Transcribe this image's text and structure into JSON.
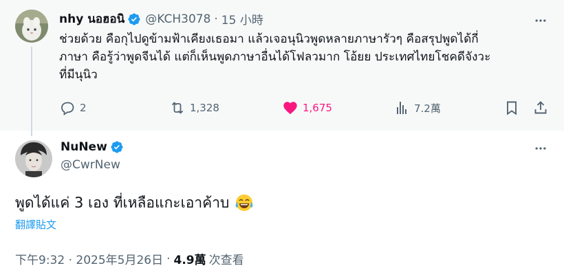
{
  "original_tweet": {
    "display_name": "nhy นอฮอนิ",
    "handle": "@KCH3078",
    "separator": "·",
    "time": "15 小時",
    "text_lines": [
      "ช่วยด้วย คือกุไปดูข้ามฟ้าเคียงเธอมา แล้วเจอนุนิวพูดหลายภาษารัวๆ คือสรุปพูดได้กี่",
      "ภาษา คือรู้ว่าพูดจีนได้ แต่ก็เห็นพูดภาษาอื่นได้โฟลวมาก โอ้ยย ประเทศไทยโชคดีจังวะ",
      "ที่มีนุนิว"
    ],
    "actions": {
      "reply_count": "2",
      "retweet_count": "1,328",
      "like_count": "1,675",
      "view_count": "7.2萬"
    }
  },
  "reply_tweet": {
    "display_name": "NuNew",
    "handle": "@CwrNew",
    "text": "พูดได้แค่ 3 เอง ที่เหลือแกะเอาค้าบ",
    "emoji": "😂",
    "translate_label": "翻譯貼文",
    "meta": {
      "timestamp": "下午9:32 · 2025年5月26日",
      "separator": "·",
      "views_count": "4.9萬",
      "views_label": "次查看"
    }
  },
  "colors": {
    "verified_badge": "#1d9bf0",
    "like_active": "#f91880",
    "secondary_text": "#536471",
    "link": "#1d9bf0",
    "thread_line": "#cfd9de"
  },
  "icons": [
    "more-icon",
    "verified-badge-icon",
    "reply-icon",
    "retweet-icon",
    "like-icon",
    "views-icon",
    "bookmark-icon",
    "share-icon"
  ]
}
